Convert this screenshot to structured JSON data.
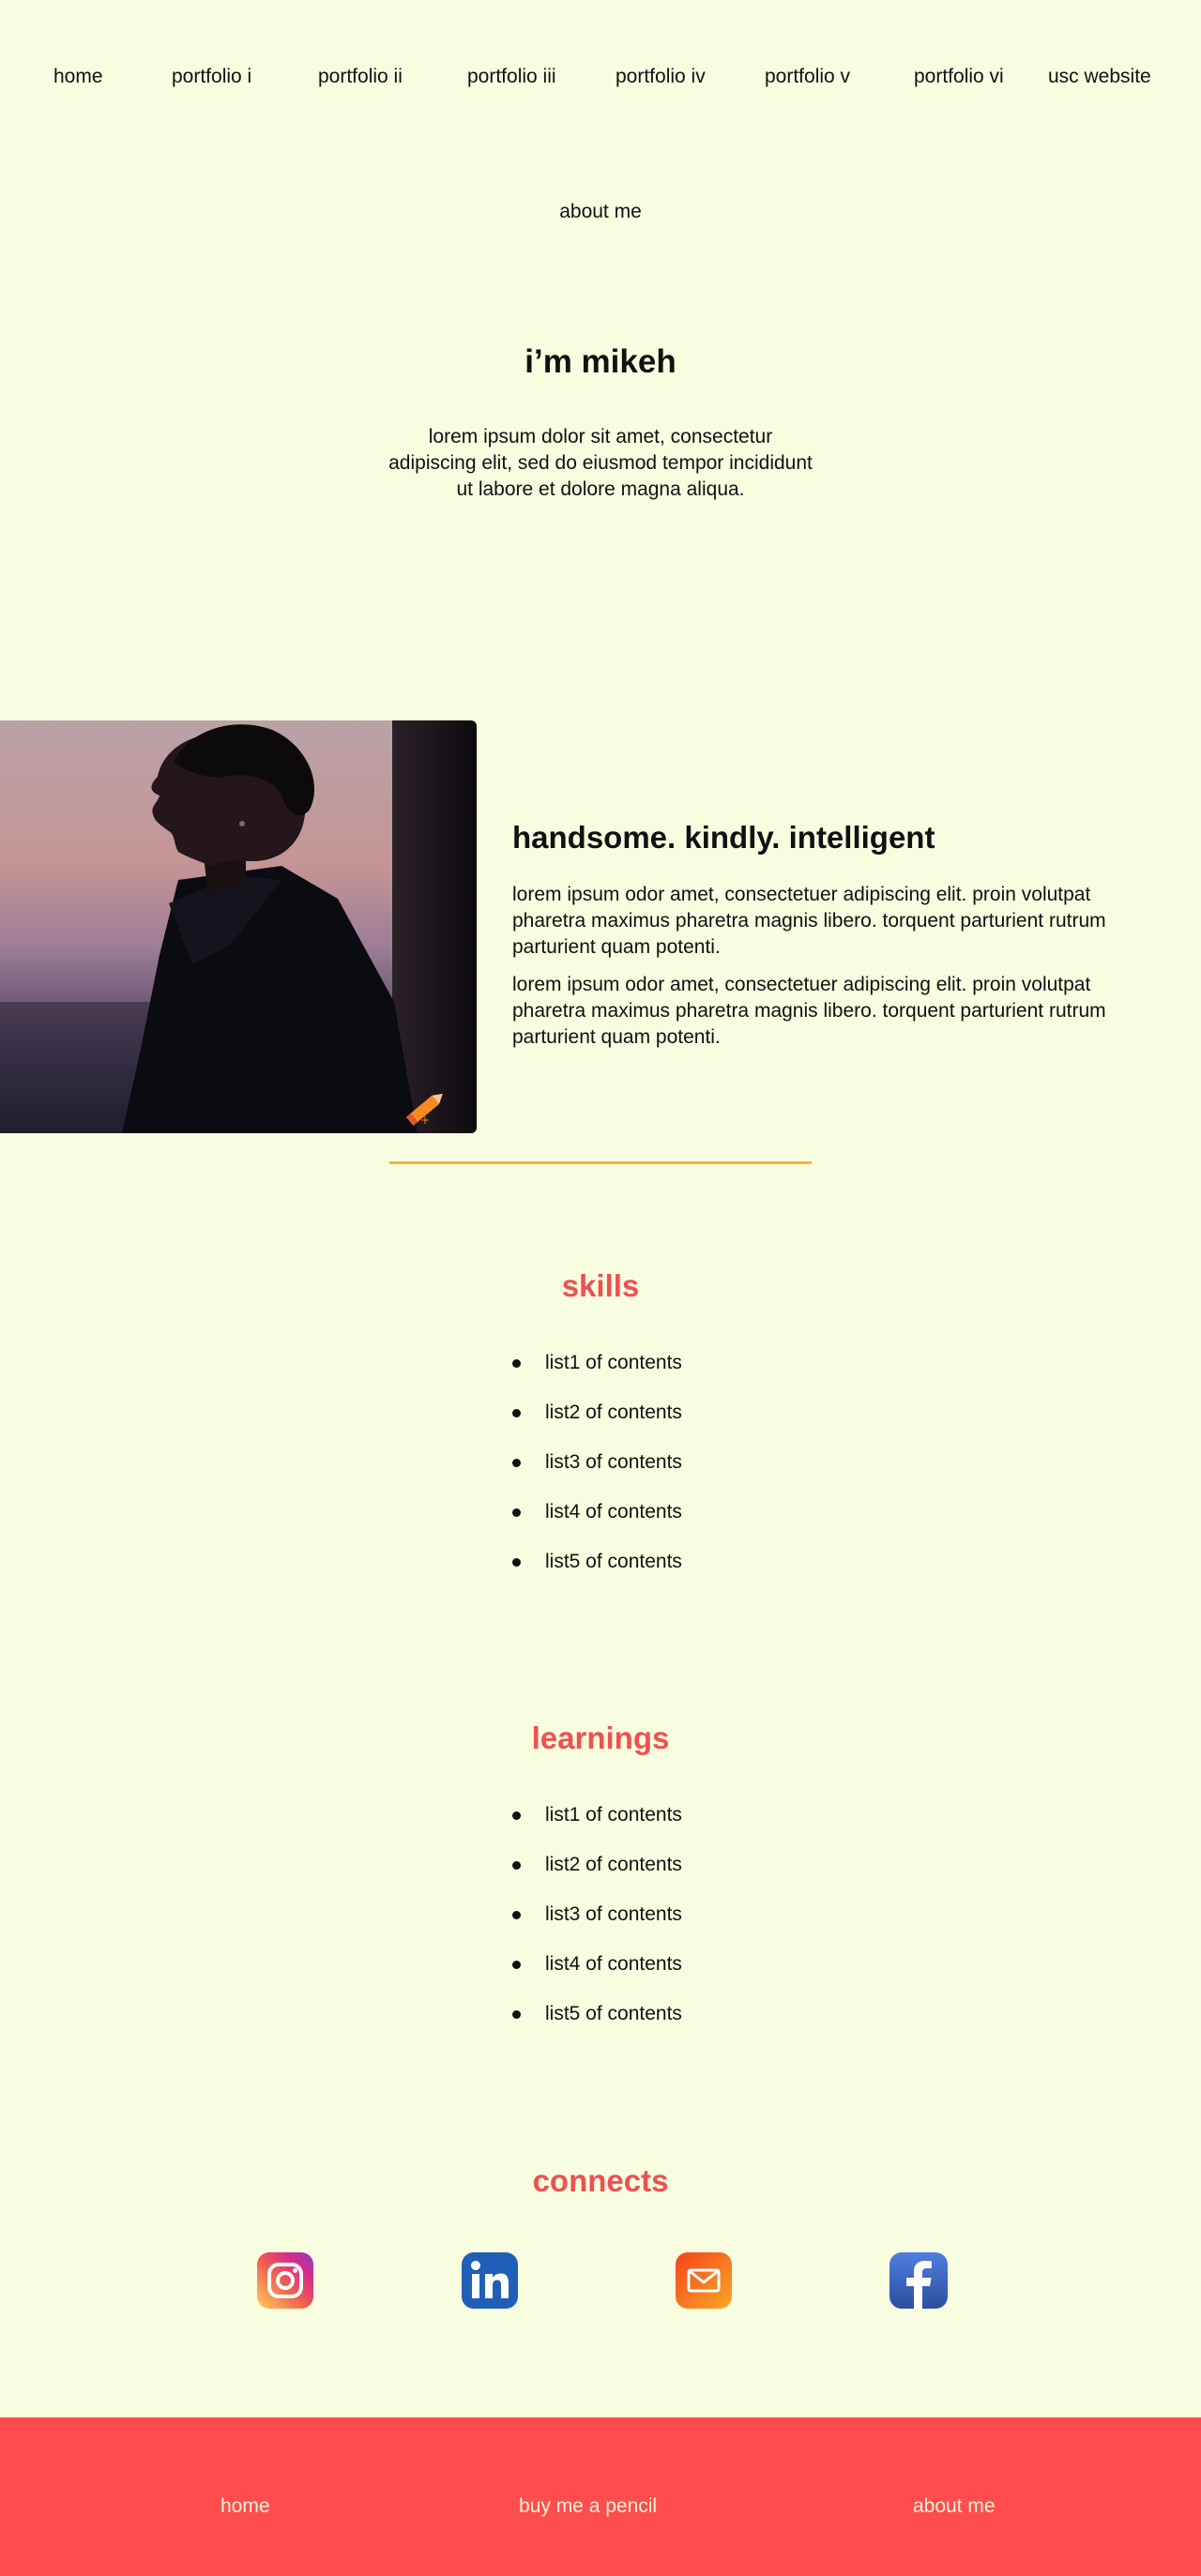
{
  "nav": {
    "items": [
      "home",
      "portfolio i",
      "portfolio ii",
      "portfolio iii",
      "portfolio iv",
      "portfolio v",
      "portfolio vi",
      "usc website"
    ],
    "about_link": "about me"
  },
  "hero": {
    "title": "i’m mikeh",
    "text": "lorem ipsum dolor sit amet, consectetur adipiscing elit, sed do eiusmod tempor incididunt ut labore et dolore magna aliqua."
  },
  "feature": {
    "title": "handsome. kindly. intelligent",
    "paragraphs": [
      "lorem ipsum odor amet, consectetuer adipiscing elit. proin volutpat pharetra maximus pharetra magnis libero. torquent parturient rutrum parturient quam potenti.",
      "lorem ipsum odor amet, consectetuer adipiscing elit. proin volutpat pharetra maximus pharetra magnis libero. torquent parturient rutrum parturient quam potenti."
    ]
  },
  "skills": {
    "title": "skills",
    "items": [
      "list1 of contents",
      "list2 of contents",
      "list3 of contents",
      "list4 of contents",
      "list5 of contents"
    ]
  },
  "learnings": {
    "title": "learnings",
    "items": [
      "list1 of contents",
      "list2 of contents",
      "list3 of contents",
      "list4 of contents",
      "list5 of contents"
    ]
  },
  "connects": {
    "title": "connects",
    "icons": [
      "instagram-icon",
      "linkedin-icon",
      "email-icon",
      "facebook-icon"
    ]
  },
  "footer": {
    "links": [
      "home",
      "buy me a pencil",
      "about me"
    ]
  },
  "colors": {
    "background": "#f8fde0",
    "accent": "#f05050",
    "footer": "#ff4d4d",
    "divider": "#f5b63a"
  }
}
